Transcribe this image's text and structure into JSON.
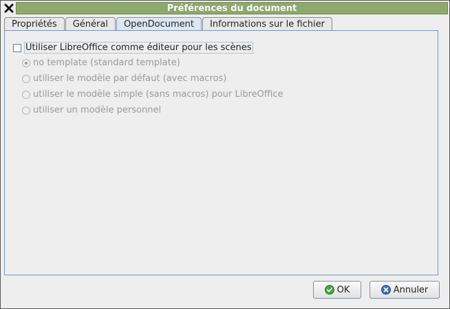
{
  "window": {
    "title": "Préférences du document"
  },
  "tabs": [
    {
      "label": "Propriétés",
      "active": false
    },
    {
      "label": "Général",
      "active": false
    },
    {
      "label": "OpenDocument",
      "active": true
    },
    {
      "label": "Informations sur le fichier",
      "active": false
    }
  ],
  "panel": {
    "checkbox": {
      "label": "Utiliser LibreOffice comme éditeur pour les scènes",
      "checked": false
    },
    "radios": [
      {
        "label": "no template (standard template)",
        "selected": true,
        "enabled": false
      },
      {
        "label": "utiliser le modèle par défaut (avec macros)",
        "selected": false,
        "enabled": false
      },
      {
        "label": "utiliser le modèle simple (sans macros) pour LibreOffice",
        "selected": false,
        "enabled": false
      },
      {
        "label": "utiliser un modèle personnel",
        "selected": false,
        "enabled": false
      }
    ]
  },
  "buttons": {
    "ok": "OK",
    "cancel": "Annuler"
  },
  "icons": {
    "close": "close-icon",
    "ok": "check-circle-icon",
    "cancel": "cancel-circle-icon"
  },
  "colors": {
    "titlebar": "#8da96d",
    "active_tab": "#dce7f3",
    "ok_icon": "#3fa83a",
    "cancel_icon": "#3a6fc4"
  }
}
